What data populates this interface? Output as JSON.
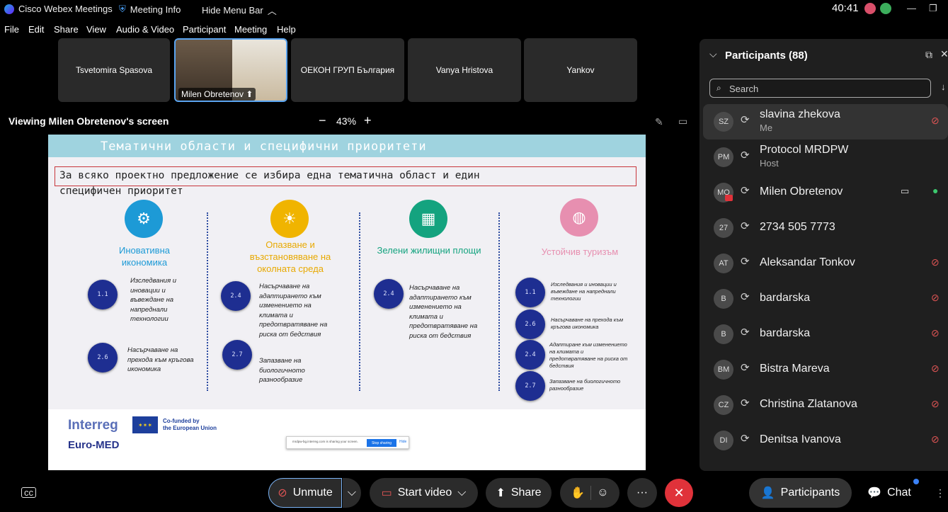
{
  "titlebar": {
    "app_name": "Cisco Webex Meetings",
    "meeting_info": "Meeting Info",
    "hide_menu": "Hide Menu Bar",
    "timer": "40:41"
  },
  "menu": [
    "File",
    "Edit",
    "Share",
    "View",
    "Audio & Video",
    "Participant",
    "Meeting",
    "Help"
  ],
  "tiles": [
    {
      "name": "Tsvetomira Spasova"
    },
    {
      "name": "Milen Obretenov"
    },
    {
      "name": "ОЕКОН ГРУП България"
    },
    {
      "name": "Vanya Hristova"
    },
    {
      "name": "Yankov"
    }
  ],
  "viewing": {
    "label": "Viewing Milen Obretenov's screen",
    "zoom": "43%",
    "minus": "−",
    "plus": "+"
  },
  "slide": {
    "title": "Тематични области и специфични приоритети",
    "intro_line1": "За всяко проектно предложение се избира една тематична област и един",
    "intro_line2": "специфичен приоритет",
    "columns": [
      {
        "title": "Иновативна икономика",
        "color": "#1d9ad6",
        "items": [
          {
            "code": "1.1",
            "text": "Изследвания и иновации и въвеждане на напреднали технологии"
          },
          {
            "code": "2.6",
            "text": "Насърчаване на прехода към кръгова икономика"
          }
        ]
      },
      {
        "title": "Опазване и възстановяване на околната среда",
        "color": "#f0b400",
        "items": [
          {
            "code": "2.4",
            "text": "Насърчаване на адаптирането към изменението на климата и предотвратяване на риска от бедствия"
          },
          {
            "code": "2.7",
            "text": "Запазване на биологичното разнообразие"
          }
        ]
      },
      {
        "title": "Зелени жилищни площи",
        "color": "#14a37f",
        "items": [
          {
            "code": "2.4",
            "text": "Насърчаване на адаптирането към изменението на климата и предотвратяване на риска от бедствия"
          }
        ]
      },
      {
        "title": "Устойчив туризъм",
        "color": "#e78fb0",
        "items": [
          {
            "code": "1.1",
            "text": "Изследвания и иновации и въвеждане на напреднали технологии"
          },
          {
            "code": "2.6",
            "text": "Насърчаване на прехода към кръгова икономика"
          },
          {
            "code": "2.4",
            "text": "Адаптиране към изменението на климата и предотвратяване на риска от бедствия"
          },
          {
            "code": "2.7",
            "text": "Запазване на биологичното разнообразие"
          }
        ]
      }
    ],
    "footer": {
      "interreg": "Interreg",
      "euromed": "Euro-MED",
      "cofunded": "Co-funded by\nthe European Union",
      "share_text": "mrdpw-bg.interreg.com is sharing your screen.",
      "stop_sharing": "Stop sharing",
      "hide": "Hide"
    }
  },
  "toolbar": {
    "unmute": "Unmute",
    "start_video": "Start video",
    "share": "Share",
    "participants": "Participants",
    "chat": "Chat"
  },
  "sidebar": {
    "title": "Participants (88)",
    "search_placeholder": "Search",
    "participants": [
      {
        "initials": "SZ",
        "name": "slavina zhekova",
        "sub": "Me",
        "muted": true
      },
      {
        "initials": "PM",
        "name": "Protocol MRDPW",
        "sub": "Host",
        "muted": false
      },
      {
        "initials": "MO",
        "name": "Milen Obretenov",
        "sub": "",
        "muted": false
      },
      {
        "initials": "27",
        "name": "2734 505 7773",
        "sub": "",
        "muted": false
      },
      {
        "initials": "AT",
        "name": "Aleksandar Tonkov",
        "sub": "",
        "muted": true
      },
      {
        "initials": "B",
        "name": "bardarska",
        "sub": "",
        "muted": true
      },
      {
        "initials": "B",
        "name": "bardarska",
        "sub": "",
        "muted": true
      },
      {
        "initials": "BM",
        "name": "Bistra Mareva",
        "sub": "",
        "muted": true
      },
      {
        "initials": "CZ",
        "name": "Christina Zlatanova",
        "sub": "",
        "muted": true
      },
      {
        "initials": "DI",
        "name": "Denitsa Ivanova",
        "sub": "",
        "muted": true
      }
    ]
  },
  "colors": {
    "accent": "#5aa4f0",
    "leave": "#e0323a",
    "mute": "#e05555",
    "talking": "#3cc86e"
  }
}
